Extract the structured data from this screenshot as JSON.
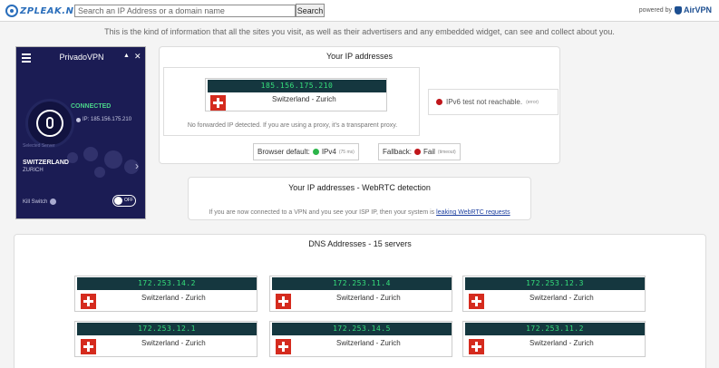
{
  "header": {
    "logo_text": "ZPLEAK.NET",
    "search_placeholder": "Search an IP Address or a domain name",
    "search_button": "Search",
    "powered_by": "powered by",
    "brand": "AirVPN"
  },
  "intro": "This is the kind of information that all the sites you visit, as well as their advertisers and any embedded widget, can see and collect about you.",
  "vpn_widget": {
    "app_name": "PrivadoVPN",
    "status": "CONNECTED",
    "ip": "IP: 185.156.175.210",
    "selected_label": "Selected Server",
    "country": "SWITZERLAND",
    "city": "ZURICH",
    "kill_switch": "Kill Switch",
    "toggle": "OFF"
  },
  "ip_addresses": {
    "title": "Your IP addresses",
    "ip": "185.156.175.210",
    "location": "Switzerland - Zurich",
    "no_forward": "No forwarded IP detected. If you are using a proxy, it's a transparent proxy.",
    "ipv6": "IPv6 test not reachable.",
    "ipv6_note": "(error)",
    "browser_default_label": "Browser default:",
    "browser_default_value": "IPv4",
    "browser_default_ms": "(75 ms)",
    "fallback_label": "Fallback:",
    "fallback_value": "Fail",
    "fallback_note": "(timeout)"
  },
  "webrtc": {
    "title": "Your IP addresses - WebRTC detection",
    "text": "If you are now connected to a VPN and you see your ISP IP, then your system is",
    "link": "leaking WebRTC requests"
  },
  "dns": {
    "title": "DNS Addresses - 15 servers",
    "servers": [
      {
        "ip": "172.253.14.2",
        "location": "Switzerland - Zurich"
      },
      {
        "ip": "172.253.11.4",
        "location": "Switzerland - Zurich"
      },
      {
        "ip": "172.253.12.3",
        "location": "Switzerland - Zurich"
      },
      {
        "ip": "172.253.12.1",
        "location": "Switzerland - Zurich"
      },
      {
        "ip": "172.253.14.5",
        "location": "Switzerland - Zurich"
      },
      {
        "ip": "172.253.11.2",
        "location": "Switzerland - Zurich"
      }
    ]
  },
  "colors": {
    "vpn_bg": "#1b1c54",
    "connected": "#4ad38a",
    "ip_bg": "#15373f",
    "ip_text": "#35e07b",
    "swiss_red": "#d52b1e"
  }
}
